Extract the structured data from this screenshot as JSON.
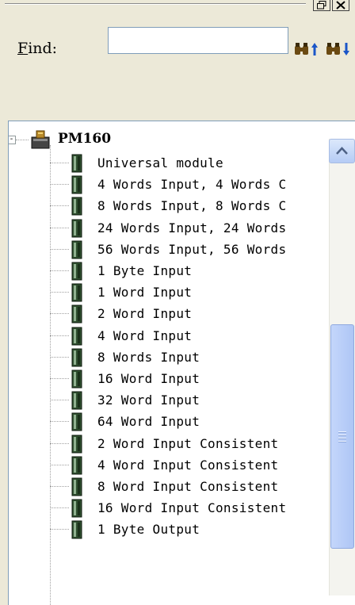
{
  "find": {
    "label_prefix": "",
    "label_hotkey": "F",
    "label_rest": "ind:",
    "input_value": "",
    "find_up_glyph": "♞",
    "find_down_glyph": "♞",
    "icons": {
      "find_up": "binoculars-up-arrow-icon",
      "find_down": "binoculars-down-arrow-icon",
      "restore": "restore-window-icon",
      "close": "close-icon"
    }
  },
  "tree": {
    "root": {
      "label": "PM160",
      "expander": "-",
      "icon": "device-module-icon"
    },
    "item_icon": "slot-module-icon",
    "items": [
      {
        "label": "Universal module"
      },
      {
        "label": "4 Words Input, 4 Words C"
      },
      {
        "label": "8 Words Input, 8 Words C"
      },
      {
        "label": "24 Words Input, 24 Words"
      },
      {
        "label": "56 Words Input, 56 Words"
      },
      {
        "label": "1 Byte Input"
      },
      {
        "label": "1 Word Input"
      },
      {
        "label": "2 Word Input"
      },
      {
        "label": "4 Word Input"
      },
      {
        "label": "8 Words Input"
      },
      {
        "label": "16 Word Input"
      },
      {
        "label": "32 Word Input"
      },
      {
        "label": "64 Word Input"
      },
      {
        "label": "2 Word Input Consistent"
      },
      {
        "label": "4 Word Input Consistent"
      },
      {
        "label": "8 Word Input Consistent"
      },
      {
        "label": "16 Word Input Consistent"
      },
      {
        "label": "1 Byte Output"
      }
    ]
  },
  "colors": {
    "window_bg": "#ece9d8",
    "scroll_thumb": "#b9cefa",
    "tree_bg": "#ffffff"
  }
}
